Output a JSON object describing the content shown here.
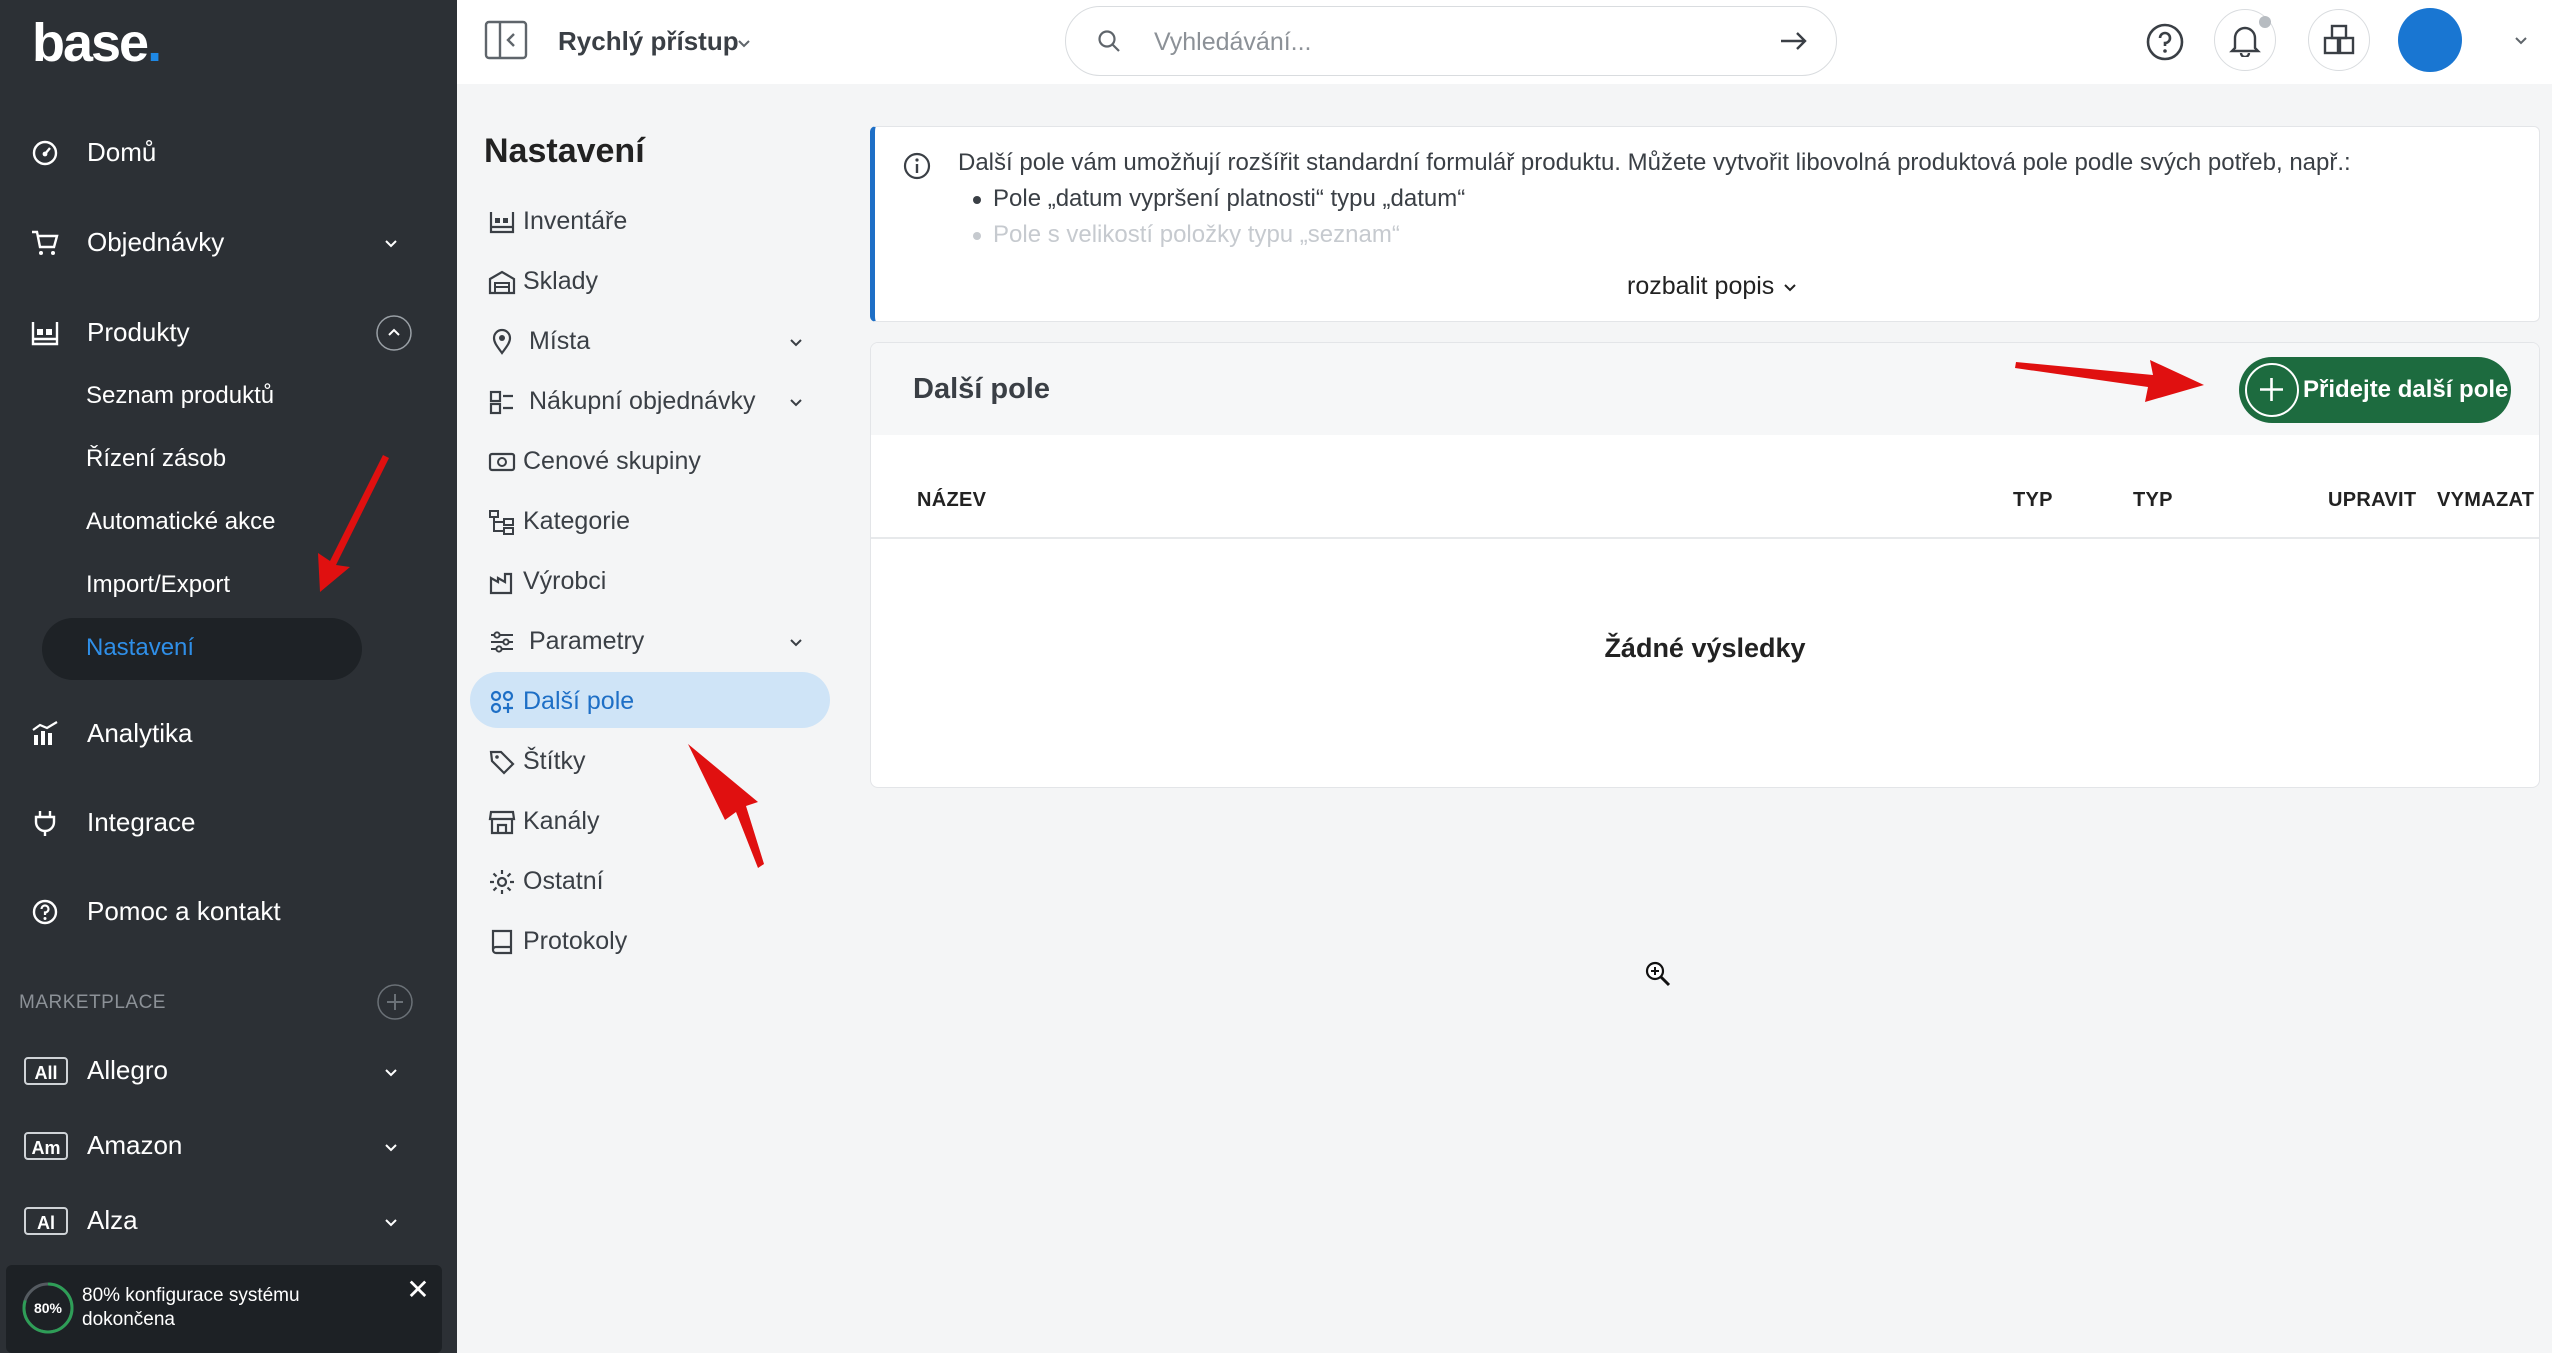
{
  "app": {
    "logo_text": "base",
    "logo_dot": ".",
    "brand_color": "#1e88e5"
  },
  "sidebar": {
    "items": [
      {
        "label": "Domů",
        "icon": "dashboard-icon"
      },
      {
        "label": "Objednávky",
        "icon": "cart-icon"
      },
      {
        "label": "Produkty",
        "icon": "products-icon"
      },
      {
        "label": "Analytika",
        "icon": "analytics-icon"
      },
      {
        "label": "Integrace",
        "icon": "plug-icon"
      },
      {
        "label": "Pomoc a kontakt",
        "icon": "help-icon"
      }
    ],
    "products_sub": [
      "Seznam produktů",
      "Řízení zásob",
      "Automatické akce",
      "Import/Export",
      "Nastavení"
    ],
    "marketplace_label": "MARKETPLACE",
    "marketplaces": [
      {
        "badge": "All",
        "label": "Allegro"
      },
      {
        "badge": "Am",
        "label": "Amazon"
      },
      {
        "badge": "Al",
        "label": "Alza"
      }
    ],
    "config_progress": {
      "percent_label": "80%",
      "value": 80,
      "text": "80% konfigurace systému dokončena",
      "close": "✕"
    }
  },
  "topbar": {
    "quick_access": "Rychlý přístup",
    "search_placeholder": "Vyhledávání..."
  },
  "settings": {
    "title": "Nastavení",
    "items": [
      {
        "label": "Inventáře",
        "icon": "inventory-icon"
      },
      {
        "label": "Sklady",
        "icon": "warehouse-icon"
      },
      {
        "label": "Místa",
        "icon": "location-pin-icon"
      },
      {
        "label": "Nákupní objednávky",
        "icon": "purchase-orders-icon"
      },
      {
        "label": "Cenové skupiny",
        "icon": "price-group-icon"
      },
      {
        "label": "Kategorie",
        "icon": "category-tree-icon"
      },
      {
        "label": "Výrobci",
        "icon": "factory-icon"
      },
      {
        "label": "Parametry",
        "icon": "sliders-icon"
      },
      {
        "label": "Další pole",
        "icon": "extra-fields-icon"
      },
      {
        "label": "Štítky",
        "icon": "tag-icon"
      },
      {
        "label": "Kanály",
        "icon": "storefront-icon"
      },
      {
        "label": "Ostatní",
        "icon": "gear-icon"
      },
      {
        "label": "Protokoly",
        "icon": "log-book-icon"
      }
    ]
  },
  "info": {
    "text": "Další pole vám umožňují rozšířit standardní formulář produktu. Můžete vytvořit libovolná produktová pole podle svých potřeb, např.:",
    "examples": [
      "Pole „datum vypršení platnosti“ typu „datum“",
      "Pole s velikostí položky typu „seznam“"
    ],
    "expand_label": "rozbalit popis"
  },
  "fields": {
    "title": "Další pole",
    "add_button": "Přidejte další pole",
    "columns": [
      "NÁZEV",
      "TYP",
      "TYP",
      "UPRAVIT",
      "VYMAZAT"
    ],
    "empty_text": "Žádné výsledky"
  },
  "colors": {
    "sidebar_bg": "#2c3035",
    "accent_blue": "#1e6fc6",
    "add_button_green": "#1d6b3f",
    "annotation_red": "#e01010"
  }
}
